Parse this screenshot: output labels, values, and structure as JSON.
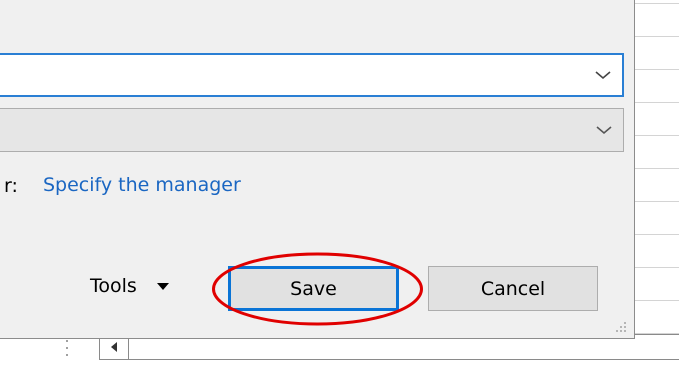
{
  "dialog": {
    "field_label_fragment": "r:",
    "manager_link": "Specify the manager",
    "tools_label": "Tools",
    "save_label": "Save",
    "cancel_label": "Cancel"
  },
  "icons": {
    "dropdown": "chevron-down-icon",
    "tools_menu": "caret-down-icon",
    "resize": "resize-grip-icon",
    "scroll_left": "scroll-left-icon"
  },
  "colors": {
    "focus_border": "#2a7fd4",
    "link": "#1a66c2",
    "annotation": "#e00000"
  }
}
